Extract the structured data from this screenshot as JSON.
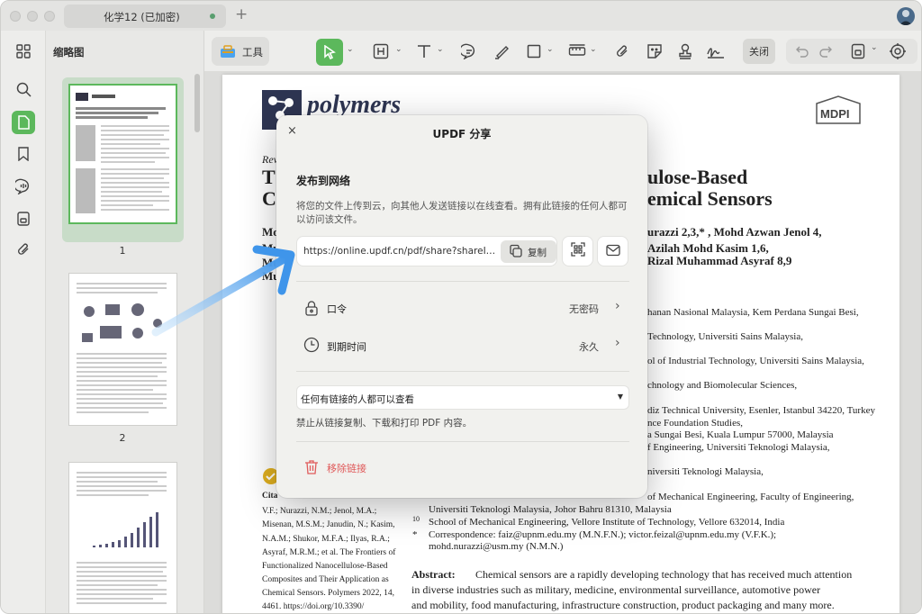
{
  "app": {
    "tab_title": "化学12 (已加密)",
    "tab_add": "+"
  },
  "sidebar": {
    "panel_title": "缩略图",
    "rail_icons": [
      "grid-icon",
      "search-icon",
      "page-icon",
      "bookmark-icon",
      "comment-icon",
      "attachment-page-icon",
      "paperclip-icon"
    ],
    "thumbnails": [
      {
        "number": "1"
      },
      {
        "number": "2"
      }
    ]
  },
  "toolbar": {
    "tools_label": "工具",
    "close_label": "关闭"
  },
  "document": {
    "journal": "polymers",
    "publisher": "MDPI",
    "title_line1": "T",
    "title_line1_right": "ulose-Based",
    "title_line2": "C",
    "title_line2_right": "emical Sensors",
    "review_label": "Rev",
    "authors_right": [
      "urazzi 2,3,* , Mohd Azwan Jenol 4,",
      "Azilah Mohd Kasim 1,6,",
      "Rizal Muhammad Asyraf 8,9"
    ],
    "affiliations_right": [
      "hanan Nasional Malaysia, Kem Perdana Sungai Besi,",
      "Technology, Universiti Sains Malaysia,",
      "ol of Industrial Technology, Universiti Sains Malaysia,",
      "chnology and Biomolecular Sciences,",
      "diz Technical University, Esenler, Istanbul 34220, Turkey",
      "nce Foundation Studies,",
      "a Sungai Besi, Kuala Lumpur 57000, Malaysia",
      "f Engineering, Universiti Teknologi Malaysia,",
      "niversiti Teknologi Malaysia,"
    ],
    "affil_bottom": [
      "of Mechanical Engineering, Faculty of Engineering,",
      "Universiti Teknologi Malaysia, Johor Bahru 81310, Malaysia",
      "School of Mechanical Engineering, Vellore Institute of Technology, Vellore 632014, India",
      "Correspondence: faiz@upnm.edu.my (M.N.F.N.); victor.feizal@upnm.edu.my (V.F.K.);",
      "mohd.nurazzi@usm.my (N.M.N.)"
    ],
    "affil_num_10": "10",
    "affil_bullet": "*",
    "citation_lines": [
      "Cita",
      "V.F.; Nurazzi, N.M.; Jenol, M.A.;",
      "Misenan, M.S.M.; Janudin, N.; Kasim,",
      "N.A.M.; Shukor, M.F.A.; Ilyas, R.A.;",
      "Asyraf, M.R.M.; et al. The Frontiers of",
      "Functionalized Nanocellulose-Based",
      "Composites and Their Application as",
      "Chemical Sensors. Polymers 2022, 14,",
      "4461.  https://doi.org/10.3390/"
    ],
    "left_initials": [
      "Mo",
      "Mu",
      "Mu",
      "Mu"
    ],
    "abstract_label": "Abstract:",
    "abstract_lines": [
      "Chemical sensors are a rapidly developing technology that has received much attention",
      "in diverse industries such as military, medicine, environmental surveillance, automotive power",
      "and mobility, food manufacturing, infrastructure construction, product packaging and many more."
    ]
  },
  "dialog": {
    "title": "UPDF 分享",
    "close_symbol": "×",
    "section_title": "发布到网络",
    "description": "将您的文件上传到云，向其他人发送链接以在线查看。拥有此链接的任何人都可以访问该文件。",
    "link_url": "https://online.updf.cn/pdf/share?shareId...",
    "copy_label": "复制",
    "password_label": "口令",
    "password_value": "无密码",
    "expiry_label": "到期时间",
    "expiry_value": "永久",
    "access_option": "任何有链接的人都可以查看",
    "restriction_note": "禁止从链接复制、下载和打印 PDF 内容。",
    "remove_label": "移除链接"
  },
  "colors": {
    "accent_green": "#5cb85c",
    "danger_red": "#e05a5a",
    "arrow_blue": "#4aa3f0"
  }
}
